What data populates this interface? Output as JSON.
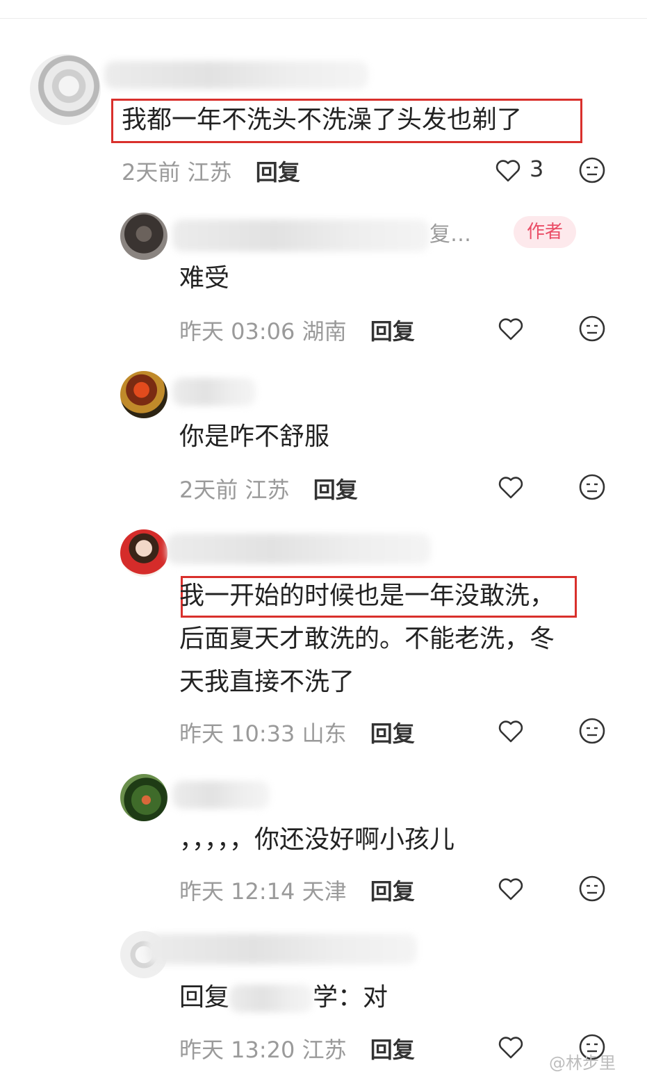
{
  "comments": [
    {
      "text": "我都一年不洗头不洗澡了头发也剃了",
      "time": "2天前",
      "location": "江苏",
      "reply_label": "回复",
      "like_count": "3",
      "icons": [
        "heart-icon",
        "neutral-face-icon"
      ]
    },
    {
      "author_badge": "作者",
      "ellipsis": "复…",
      "text": "难受",
      "time": "昨天 03:06",
      "location": "湖南",
      "reply_label": "回复"
    },
    {
      "text": "你是咋不舒服",
      "time": "2天前",
      "location": "江苏",
      "reply_label": "回复"
    },
    {
      "text_lines": [
        "我一开始的时候也是一年没敢洗，",
        "后面夏天才敢洗的。不能老洗，冬",
        "天我直接不洗了"
      ],
      "time": "昨天 10:33",
      "location": "山东",
      "reply_label": "回复"
    },
    {
      "text": "，，，，，你还没好啊小孩儿",
      "time": "昨天 12:14",
      "location": "天津",
      "reply_label": "回复"
    },
    {
      "text_prefix": "回复",
      "text_suffix": "学：对",
      "time": "昨天 13:20",
      "location": "江苏",
      "reply_label": "回复"
    }
  ],
  "watermark": "@林步里",
  "colors": {
    "highlight_box": "#d9302c",
    "author_badge_bg": "#fde9ec",
    "author_badge_text": "#ea4d66",
    "meta_text": "#9a9a9a"
  }
}
